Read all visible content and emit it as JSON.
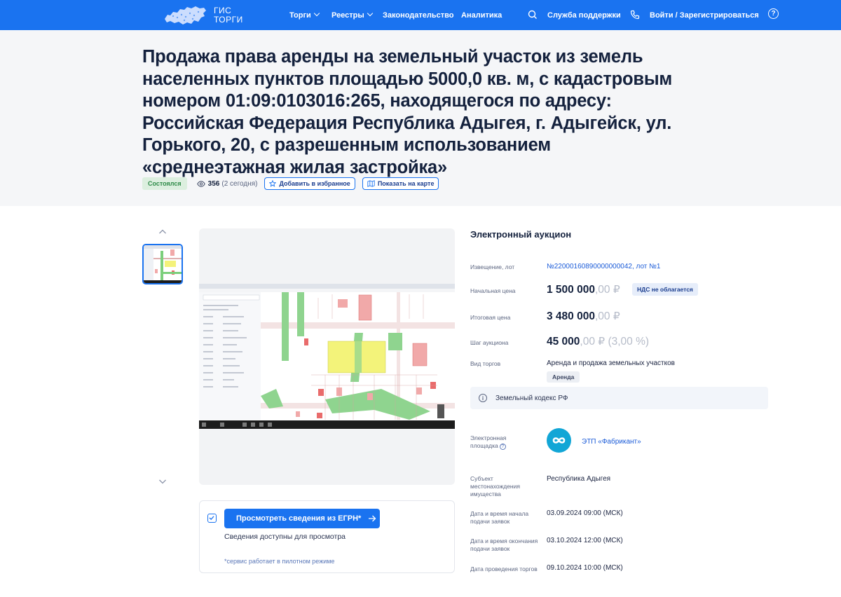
{
  "header": {
    "logo_line1": "ГИС",
    "logo_line2": "ТОРГИ",
    "nav": [
      "Торги",
      "Реестры",
      "Законодательство",
      "Аналитика"
    ],
    "support": "Служба поддержки",
    "login": "Войти / Зарегистрироваться",
    "help": "?"
  },
  "lot": {
    "title": "Продажа права аренды на земельный участок из земель населенных пунктов площадью 5000,0 кв. м, с кадастровым номером 01:09:0103016:265, находящегося по адресу: Российская Федерация Республика Адыгея, г. Адыгейск, ул. Горького, 20, с разрешенным использованием «среднеэтажная жилая застройка»",
    "status": "Состоялся",
    "views": "356",
    "views_today": "(2 сегодня)",
    "favorite_button": "Добавить в избранное",
    "map_button": "Показать на карте"
  },
  "egrn": {
    "button": "Просмотреть сведения из ЕГРН*",
    "info": "Сведения доступны для просмотра",
    "note": "*сервис работает в пилотном режиме"
  },
  "details": {
    "auction_type": "Электронный аукцион",
    "notice_label": "Извещение, лот",
    "notice_value": "№22000160890000000042, лот №1",
    "start_price_label": "Начальная цена",
    "start_price_int": "1 500 000",
    "start_price_frac": ",00 ₽",
    "vat_badge": "НДС не облагается",
    "final_price_label": "Итоговая цена",
    "final_price_int": "3 480 000",
    "final_price_frac": ",00 ₽",
    "step_label": "Шаг аукциона",
    "step_int": "45 000",
    "step_frac": ",00 ₽ (3,00 %)",
    "trade_kind_label": "Вид торгов",
    "trade_kind_value": "Аренда и продажа земельных участков",
    "trade_kind_tag": "Аренда",
    "code_note": "Земельный кодекс РФ",
    "platform_label_1": "Электронная",
    "platform_label_2": "площадка",
    "platform_value": "ЭТП «Фабрикант»",
    "subject_label": "Субъект местонахождения имущества",
    "subject_value": "Республика Адыгея",
    "start_date_label": "Дата и время начала подачи заявок",
    "start_date_value": "03.09.2024 09:00 (МСК)",
    "end_date_label": "Дата и время окончания подачи заявок",
    "end_date_value": "03.10.2024 12:00 (МСК)",
    "auction_date_label": "Дата проведения торгов",
    "auction_date_value": "09.10.2024 10:00 (МСК)"
  },
  "colors": {
    "brand_blue": "#1a73f0",
    "title_band": "#f5f6f8",
    "status_green": "#2e8b48"
  }
}
